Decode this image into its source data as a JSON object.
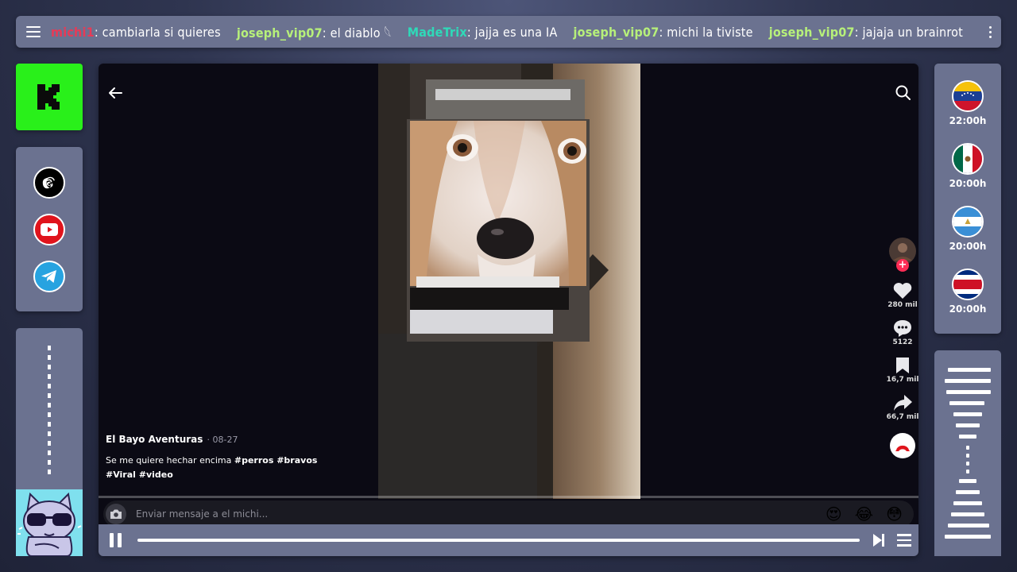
{
  "chat": {
    "messages": [
      {
        "user": "michi1",
        "user_color": "#e83a56",
        "text": ": cambiarla si quieres"
      },
      {
        "user": "joseph_vip07",
        "user_color": "#b7f07a",
        "text": ": el diablo 𓆩"
      },
      {
        "user": "MadeTrix",
        "user_color": "#2fd9b8",
        "text": ": jajja es una IA"
      },
      {
        "user": "joseph_vip07",
        "user_color": "#b7f07a",
        "text": ": michi la tiviste"
      },
      {
        "user": "joseph_vip07",
        "user_color": "#b7f07a",
        "text": ": jajaja un brainrot"
      }
    ]
  },
  "sidebar": {
    "logo": "kick-logo",
    "socials": [
      {
        "name": "threads-icon",
        "color": "#000000"
      },
      {
        "name": "youtube-icon",
        "color": "#e0141c"
      },
      {
        "name": "telegram-icon",
        "color": "#27a3e0"
      }
    ]
  },
  "video": {
    "author": "El Bayo Aventuras",
    "date": "· 08-27",
    "description_plain": "Se me quiere hechar encima",
    "hashtags_line1": "#perros #bravos",
    "hashtags_line2": "#Viral #video",
    "likes": "280 mil",
    "comments": "5122",
    "saves": "16,7 mil",
    "shares": "66,7 mil",
    "progress": 0
  },
  "message_input": {
    "placeholder": "Enviar mensaje a el michi...",
    "emojis": [
      "😍",
      "😂",
      "😳"
    ]
  },
  "player": {
    "seek_progress": 0
  },
  "schedule": [
    {
      "country": "Venezuela",
      "flag": "venezuela-flag",
      "time": "22:00h"
    },
    {
      "country": "Mexico",
      "flag": "mexico-flag",
      "time": "20:00h"
    },
    {
      "country": "Nicaragua",
      "flag": "nicaragua-flag",
      "time": "20:00h"
    },
    {
      "country": "Costa Rica",
      "flag": "costa-rica-flag",
      "time": "20:00h"
    }
  ],
  "colors": {
    "panel": "#6b7290",
    "kick_green": "#29f01a"
  }
}
